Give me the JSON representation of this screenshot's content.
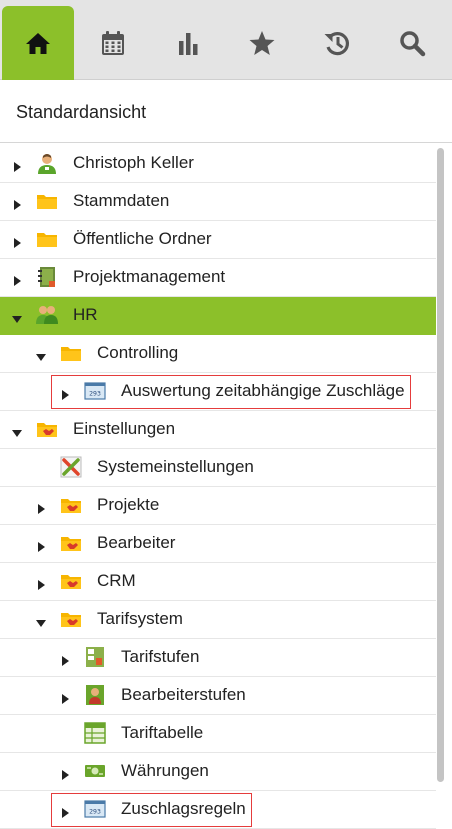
{
  "tabs": [
    {
      "icon": "home-icon",
      "active": true
    },
    {
      "icon": "calendar-icon",
      "active": false
    },
    {
      "icon": "bar-chart-icon",
      "active": false
    },
    {
      "icon": "star-icon",
      "active": false
    },
    {
      "icon": "history-icon",
      "active": false
    },
    {
      "icon": "search-icon",
      "active": false
    }
  ],
  "view_title": "Standardansicht",
  "accent_color": "#8cc02a",
  "highlight_color": "#e53c3c",
  "tree": [
    {
      "label": "Christoph Keller",
      "level": 0,
      "caret": "right",
      "icon": "user-icon"
    },
    {
      "label": "Stammdaten",
      "level": 0,
      "caret": "right",
      "icon": "folder-icon"
    },
    {
      "label": "Öffentliche Ordner",
      "level": 0,
      "caret": "right",
      "icon": "folder-icon"
    },
    {
      "label": "Projektmanagement",
      "level": 0,
      "caret": "right",
      "icon": "notebook-icon"
    },
    {
      "label": "HR",
      "level": 0,
      "caret": "down",
      "icon": "group-icon",
      "selected": true
    },
    {
      "label": "Controlling",
      "level": 1,
      "caret": "down",
      "icon": "folder-icon"
    },
    {
      "label": "Auswertung zeitabhängige Zuschläge",
      "level": 2,
      "caret": "right",
      "icon": "report-icon",
      "highlighted": true
    },
    {
      "label": "Einstellungen",
      "level": 0,
      "caret": "down",
      "icon": "settings-folder-icon"
    },
    {
      "label": "Systemeinstellungen",
      "level": 1,
      "caret": "none",
      "icon": "tools-icon"
    },
    {
      "label": "Projekte",
      "level": 1,
      "caret": "right",
      "icon": "settings-folder-icon"
    },
    {
      "label": "Bearbeiter",
      "level": 1,
      "caret": "right",
      "icon": "settings-folder-icon"
    },
    {
      "label": "CRM",
      "level": 1,
      "caret": "right",
      "icon": "settings-folder-icon"
    },
    {
      "label": "Tarifsystem",
      "level": 1,
      "caret": "down",
      "icon": "settings-folder-icon"
    },
    {
      "label": "Tarifstufen",
      "level": 2,
      "caret": "right",
      "icon": "tariff-levels-icon"
    },
    {
      "label": "Bearbeiterstufen",
      "level": 2,
      "caret": "right",
      "icon": "editor-levels-icon"
    },
    {
      "label": "Tariftabelle",
      "level": 2,
      "caret": "none",
      "icon": "table-icon"
    },
    {
      "label": "Währungen",
      "level": 2,
      "caret": "right",
      "icon": "currency-icon"
    },
    {
      "label": "Zuschlagsregeln",
      "level": 2,
      "caret": "right",
      "icon": "report-icon",
      "highlighted": true
    }
  ]
}
